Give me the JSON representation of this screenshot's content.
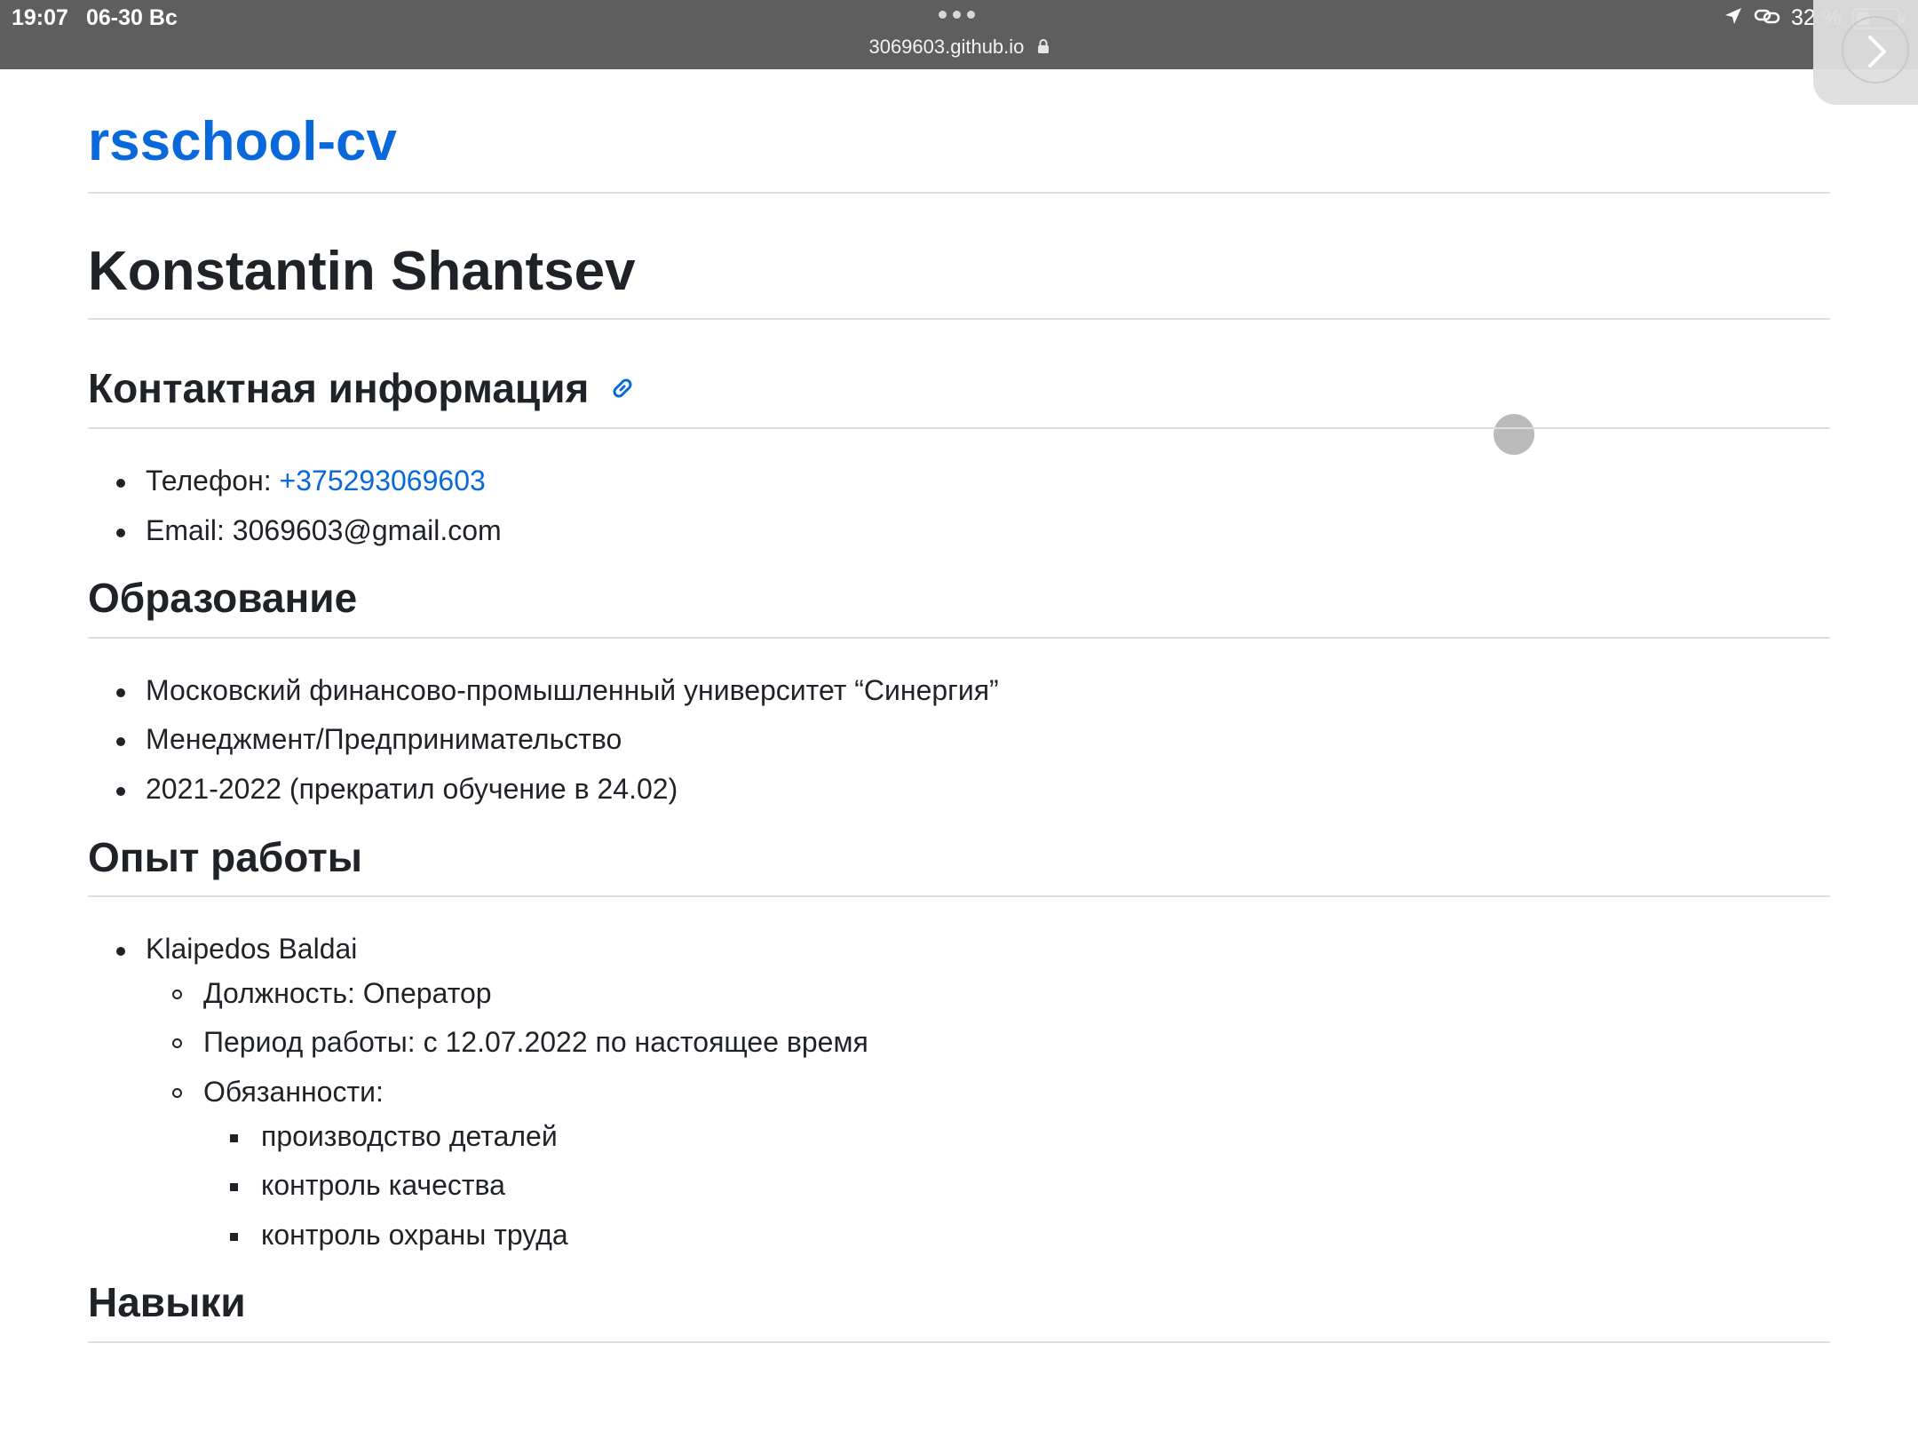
{
  "status_bar": {
    "time": "19:07",
    "date": "06-30 Вс",
    "url": "3069603.github.io",
    "battery": "32 %",
    "battery_level": 0.32
  },
  "site": {
    "title": "rsschool-cv"
  },
  "cv": {
    "name": "Konstantin Shantsev",
    "contacts": {
      "heading": "Контактная информация",
      "phone_label": "Телефон: ",
      "phone_value": "+375293069603",
      "email": "Email: 3069603@gmail.com"
    },
    "education": {
      "heading": "Образование",
      "items": [
        "Московский финансово-промышленный университет “Синергия”",
        "Менеджмент/Предпринимательство",
        "2021-2022 (прекратил обучение в 24.02)"
      ]
    },
    "experience": {
      "heading": "Опыт работы",
      "company": "Klaipedos Baldai",
      "details": [
        "Должность: Оператор",
        "Период работы: с 12.07.2022 по настоящее время",
        "Обязанности:"
      ],
      "duties": [
        "производство деталей",
        "контроль качества",
        "контроль охраны труда"
      ]
    },
    "skills": {
      "heading": "Навыки"
    }
  },
  "colors": {
    "link": "#0969da",
    "text": "#1f2328",
    "status_bar": "#5e5e5e"
  }
}
